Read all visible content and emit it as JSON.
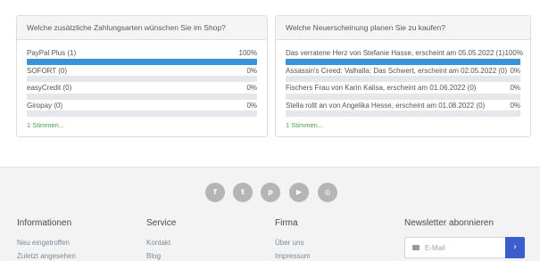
{
  "polls": [
    {
      "question": "Welche zusätzliche Zahlungsarten wünschen Sie im Shop?",
      "options": [
        {
          "label": "PayPal Plus (1)",
          "percent_text": "100%",
          "fill": 1.0
        },
        {
          "label": "SOFORT (0)",
          "percent_text": "0%",
          "fill": 0.0
        },
        {
          "label": "easyCredit (0)",
          "percent_text": "0%",
          "fill": 0.0
        },
        {
          "label": "Giropay (0)",
          "percent_text": "0%",
          "fill": 0.0
        }
      ],
      "votes_link": "1 Stimmen..."
    },
    {
      "question": "Welche Neuerscheinung planen Sie zu kaufen?",
      "options": [
        {
          "label": "Das verratene Herz von Stefanie Hasse, erscheint am 05.05.2022 (1)",
          "percent_text": "100%",
          "fill": 1.0
        },
        {
          "label": "Assassin's Creed: Valhalla: Das Schwert, erscheint am 02.05.2022 (0)",
          "percent_text": "0%",
          "fill": 0.0
        },
        {
          "label": "Fischers Frau von Karin Kalisa, erscheint am 01.06.2022 (0)",
          "percent_text": "0%",
          "fill": 0.0
        },
        {
          "label": "Stella rollt an von Angelika Hesse, erscheint am 01.08.2022 (0)",
          "percent_text": "0%",
          "fill": 0.0
        }
      ],
      "votes_link": "1 Stimmen..."
    }
  ],
  "colors": {
    "bar_fill": "#3a93d6",
    "bar_track": "#e5e7ea",
    "votes_link": "#4aa34a",
    "submit_button": "#3a5fcd",
    "social_icon": "#b5b5b5"
  },
  "socials": [
    {
      "icon": "facebook-icon",
      "glyph": "f"
    },
    {
      "icon": "twitter-icon",
      "glyph": "t"
    },
    {
      "icon": "pinterest-icon",
      "glyph": "p"
    },
    {
      "icon": "youtube-icon",
      "glyph": "▶"
    },
    {
      "icon": "instagram-icon",
      "glyph": "◎"
    }
  ],
  "footer": {
    "columns": [
      {
        "title": "Informationen",
        "links": [
          "Neu eingetroffen",
          "Zuletzt angesehen"
        ]
      },
      {
        "title": "Service",
        "links": [
          "Kontakt",
          "Blog"
        ]
      },
      {
        "title": "Firma",
        "links": [
          "Über uns",
          "Impressum"
        ]
      }
    ],
    "newsletter": {
      "title": "Newsletter abonnieren",
      "placeholder": "E-Mail",
      "email_icon": "envelope-icon",
      "submit_icon": "chevron-right-icon",
      "submit_glyph": "›"
    }
  }
}
